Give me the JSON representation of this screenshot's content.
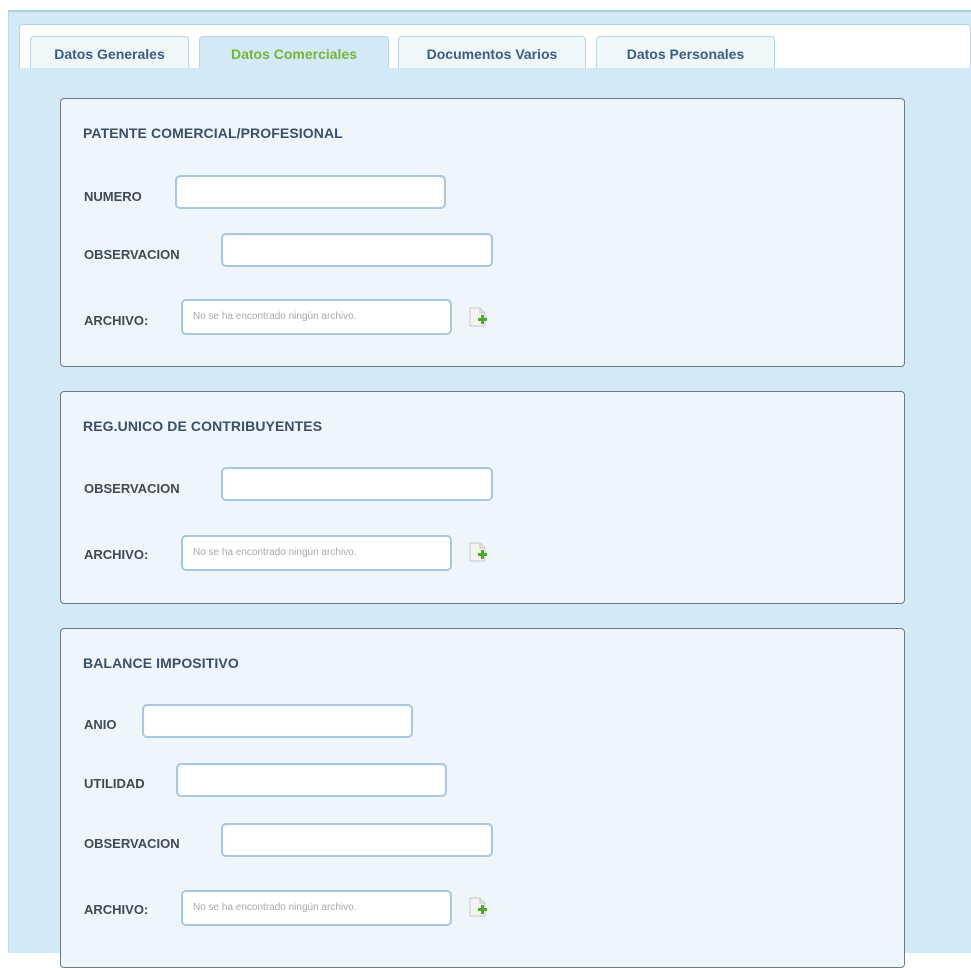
{
  "tabs": [
    {
      "label": "Datos Generales",
      "active": false
    },
    {
      "label": "Datos Comerciales",
      "active": true
    },
    {
      "label": "Documentos Varios",
      "active": false
    },
    {
      "label": "Datos Personales",
      "active": false
    }
  ],
  "colors": {
    "active_tab_text": "#74b53a",
    "tab_text": "#3b5d82",
    "panel_bg": "#eef6fb",
    "page_bg": "#d3e9f5"
  },
  "sections": {
    "patente": {
      "title": "PATENTE COMERCIAL/PROFESIONAL",
      "numero_label": "NUMERO",
      "numero_value": "",
      "observacion_label": "OBSERVACION",
      "observacion_value": "",
      "archivo_label": "ARCHIVO:",
      "archivo_text": "No se ha encontrado ningún archivo."
    },
    "ruc": {
      "title": "REG.UNICO DE CONTRIBUYENTES",
      "observacion_label": "OBSERVACION",
      "observacion_value": "",
      "archivo_label": "ARCHIVO:",
      "archivo_text": "No se ha encontrado ningún archivo."
    },
    "balance": {
      "title": "BALANCE IMPOSITIVO",
      "anio_label": "ANIO",
      "anio_value": "",
      "utilidad_label": "UTILIDAD",
      "utilidad_value": "",
      "observacion_label": "OBSERVACION",
      "observacion_value": "",
      "archivo_label": "ARCHIVO:",
      "archivo_text": "No se ha encontrado ningún archivo."
    }
  },
  "icons": {
    "add_file": "add-file-icon"
  }
}
